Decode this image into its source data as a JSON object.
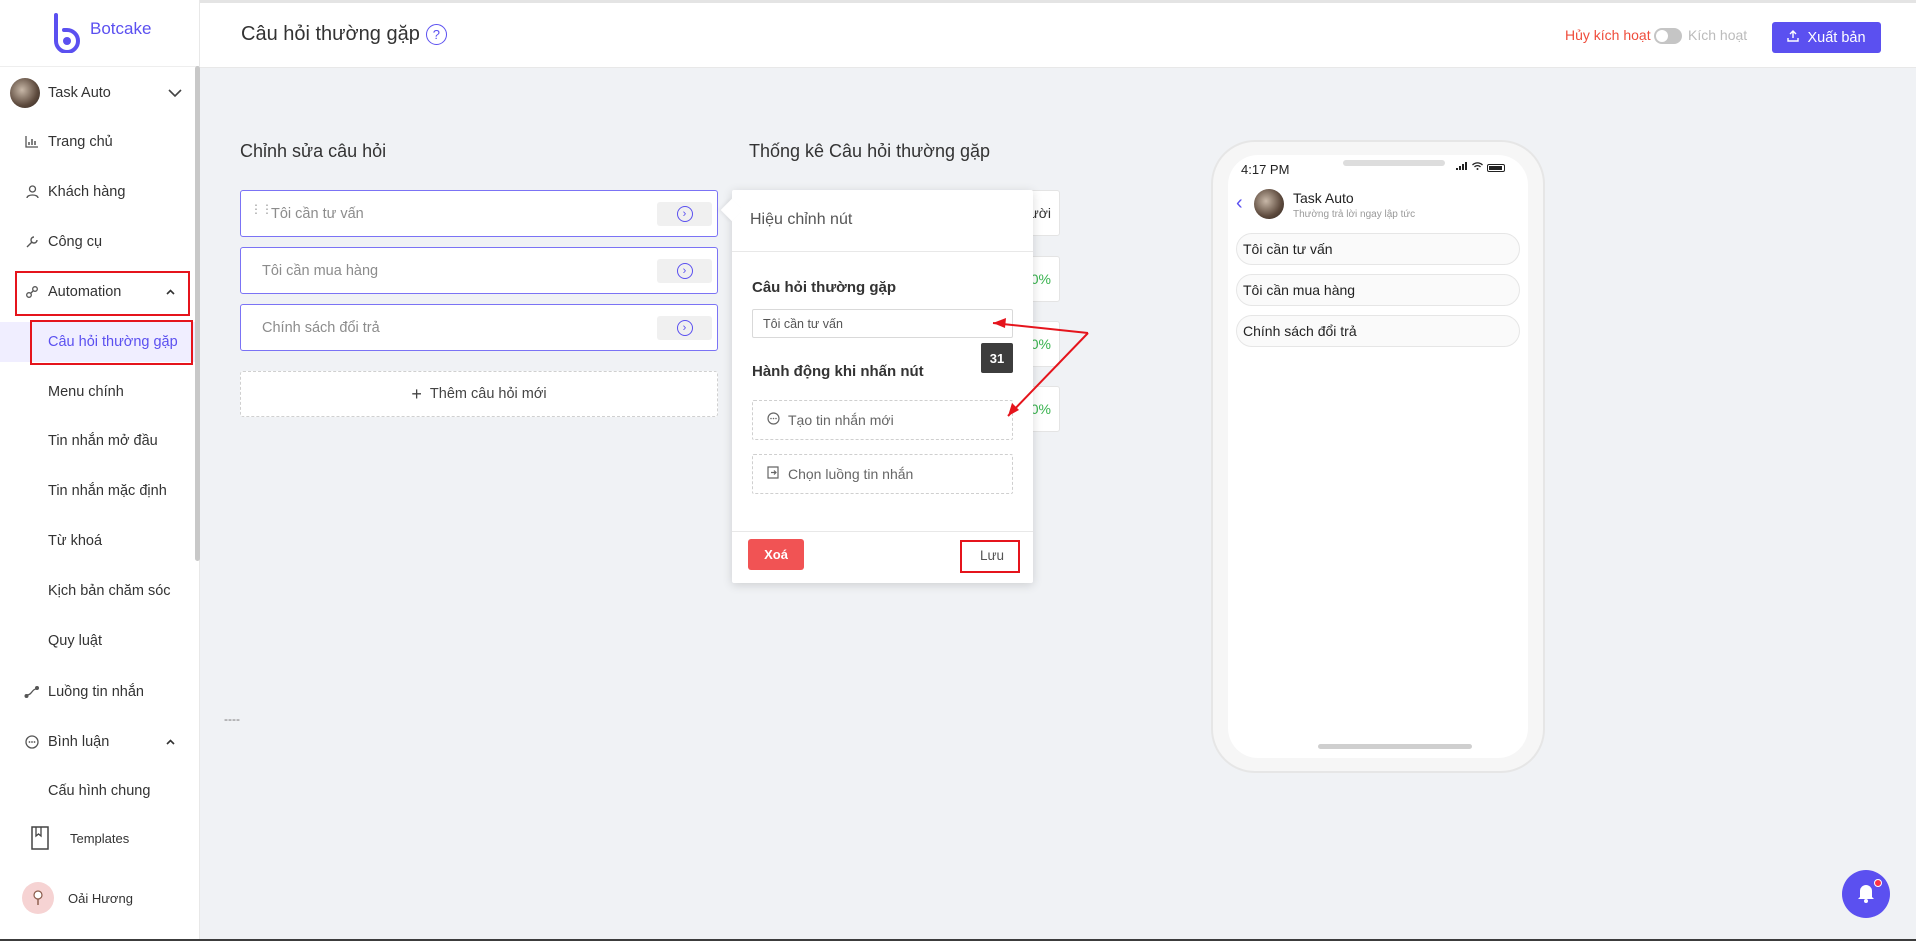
{
  "app": {
    "logo_text": "Botcake"
  },
  "header": {
    "title": "Câu hỏi thường gặp",
    "deactivate_label": "Hủy kích hoạt",
    "activate_label": "Kích hoạt",
    "publish_label": "Xuất bản",
    "toggle_on": false
  },
  "sidebar": {
    "workspace": "Task Auto",
    "items": [
      {
        "label": "Trang chủ",
        "icon": "chart-icon"
      },
      {
        "label": "Khách hàng",
        "icon": "user-icon"
      },
      {
        "label": "Công cụ",
        "icon": "wrench-icon"
      },
      {
        "label": "Automation",
        "icon": "automation-icon"
      },
      {
        "label": "Câu hỏi thường gặp"
      },
      {
        "label": "Menu chính"
      },
      {
        "label": "Tin nhắn mở đầu"
      },
      {
        "label": "Tin nhắn mặc định"
      },
      {
        "label": "Từ khoá"
      },
      {
        "label": "Kịch bản chăm sóc"
      },
      {
        "label": "Quy luật"
      },
      {
        "label": "Luồng tin nhắn",
        "icon": "flow-icon"
      },
      {
        "label": "Bình luận",
        "icon": "comment-icon"
      },
      {
        "label": "Cấu hình chung"
      },
      {
        "label": "Templates",
        "icon": "bookmark-icon"
      }
    ],
    "user_name": "Oải Hương"
  },
  "editor": {
    "title": "Chỉnh sửa câu hỏi",
    "questions": [
      "Tôi cần tư vấn",
      "Tôi cần mua hàng",
      "Chính sách đổi trả"
    ],
    "add_label": "Thêm câu hỏi mới",
    "footer_dashes": "----"
  },
  "stats": {
    "title": "Thống kê  Câu hỏi thường gặp",
    "partial_values": [
      "ười",
      "0%",
      "0%",
      "0%"
    ]
  },
  "popup": {
    "title": "Hiệu chỉnh nút",
    "faq_label": "Câu hỏi thường gặp",
    "faq_value": "Tôi cần tư vấn",
    "char_count": "31",
    "action_label": "Hành động khi nhấn nút",
    "option_new": "Tạo tin nhắn mới",
    "option_flow": "Chọn luồng tin nhắn",
    "delete_label": "Xoá",
    "save_label": "Lưu"
  },
  "phone": {
    "time": "4:17 PM",
    "page_name": "Task Auto",
    "page_sub": "Thường trả lời ngay lập tức",
    "chips": [
      "Tôi cần tư vấn",
      "Tôi cần mua hàng",
      "Chính sách đổi trả"
    ]
  },
  "colors": {
    "accent": "#5b50f0",
    "danger": "#f15354",
    "highlight": "#e5141c"
  }
}
